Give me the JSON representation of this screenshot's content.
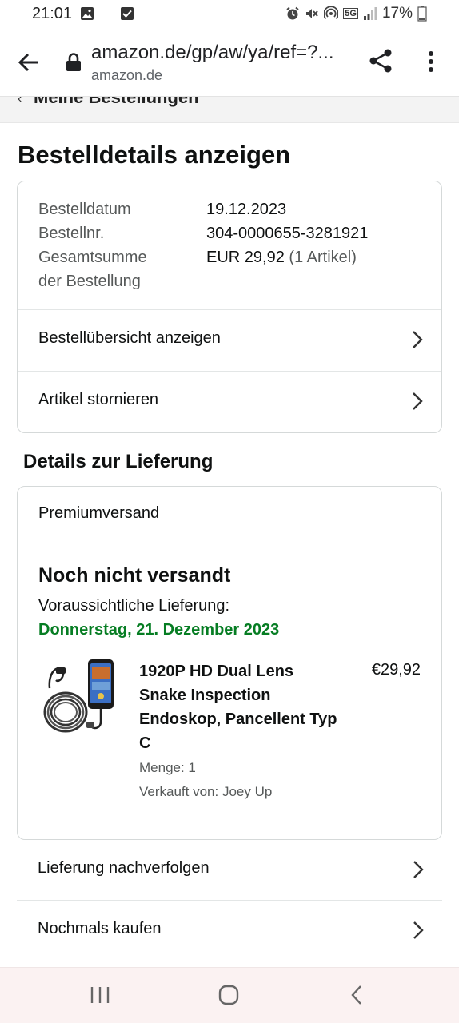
{
  "status_bar": {
    "time": "21:01",
    "network": "5G",
    "battery": "17%",
    "icons": [
      "gallery-icon",
      "checkbox-icon",
      "alarm-icon",
      "mute-icon",
      "hotspot-icon",
      "5g-icon",
      "signal-icon",
      "battery-icon"
    ]
  },
  "browser": {
    "url": "amazon.de/gp/aw/ya/ref=?...",
    "domain": "amazon.de",
    "icons": [
      "back-arrow-icon",
      "lock-icon",
      "share-icon",
      "more-vert-icon"
    ]
  },
  "breadcrumb": {
    "label": "Meine Bestellungen"
  },
  "page": {
    "title": "Bestelldetails anzeigen"
  },
  "order_summary": {
    "rows": [
      {
        "label": "Bestelldatum",
        "value": "19.12.2023"
      },
      {
        "label": "Bestellnr.",
        "value": "304-0000655-3281921"
      },
      {
        "label": "Gesamtsumme der Bestellung",
        "value": "EUR 29,92",
        "value_note": "(1 Artikel)"
      }
    ],
    "total_label_line1": "Gesamtsumme",
    "total_label_line2": "der Bestellung",
    "links": [
      {
        "label": "Bestellübersicht anzeigen"
      },
      {
        "label": "Artikel stornieren"
      }
    ]
  },
  "delivery": {
    "section_title": "Details zur Lieferung",
    "shipping_method": "Premiumversand",
    "status": "Noch nicht versandt",
    "eta_label": "Voraussichtliche Lieferung:",
    "eta_date": "Donnerstag, 21. Dezember 2023",
    "eta_color": "#067d23",
    "item": {
      "name": "1920P HD Dual Lens Snake Inspection Endoskop, Pancellent Typ C",
      "price": "€29,92",
      "quantity": "Menge: 1",
      "seller": "Verkauft von: Joey Up"
    }
  },
  "actions": [
    {
      "label": "Lieferung nachverfolgen"
    },
    {
      "label": "Nochmals kaufen"
    }
  ],
  "nav_bar": {
    "icons": [
      "recent-apps-icon",
      "home-icon",
      "back-icon"
    ]
  }
}
